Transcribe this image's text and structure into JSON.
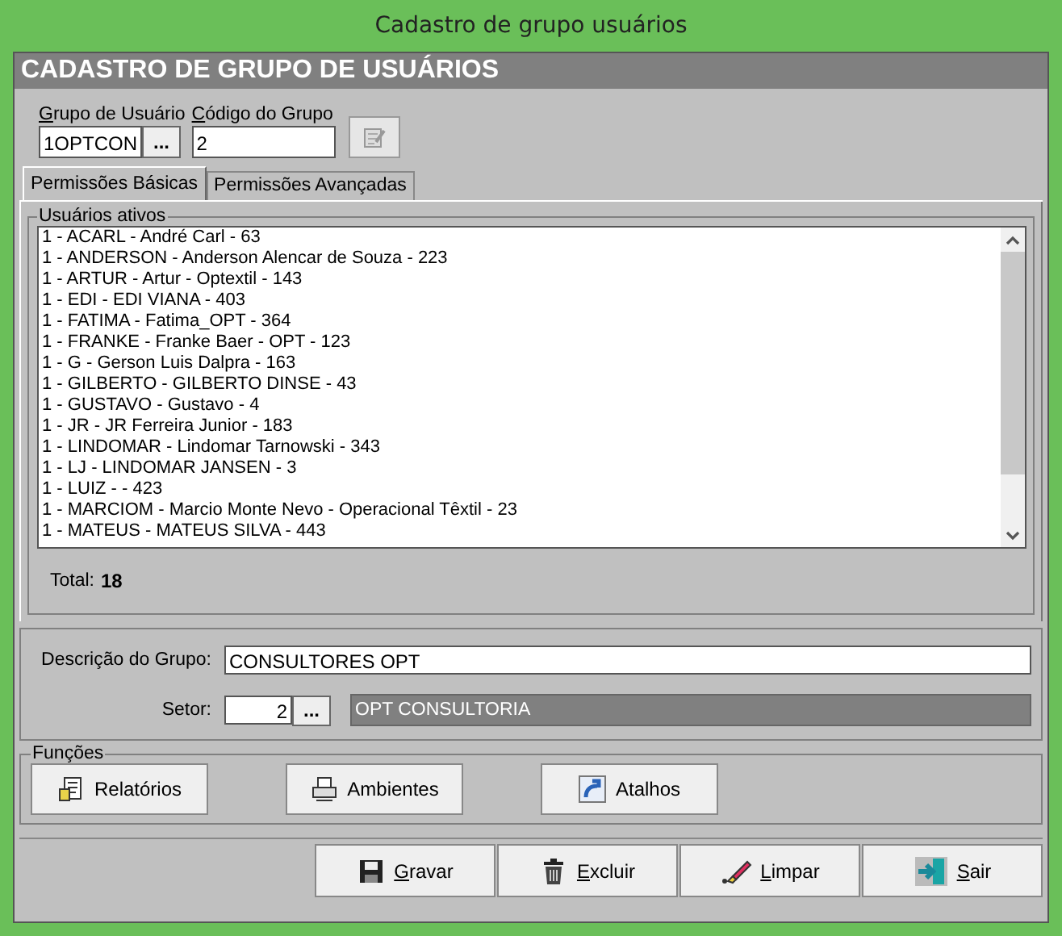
{
  "window": {
    "title": "Cadastro de grupo usuários"
  },
  "header": {
    "title": "CADASTRO DE GRUPO DE USUÁRIOS"
  },
  "top_fields": [
    {
      "label": "Grupo de Usuário",
      "value": "1OPTCON",
      "kind": "lookup",
      "button": "..."
    },
    {
      "label": "Código do Grupo",
      "value": "2",
      "kind": "text"
    }
  ],
  "tabs": [
    {
      "label": "Permissões Básicas",
      "selected": true
    },
    {
      "label": "Permissões Avançadas",
      "selected": false
    }
  ],
  "users_group": {
    "title": "Usuários ativos",
    "items": [
      "1 - ACARL - André Carl - 63",
      "1 - ANDERSON - Anderson Alencar de Souza - 223",
      "1 - ARTUR - Artur - Optextil - 143",
      "1 - EDI - EDI VIANA - 403",
      "1 - FATIMA - Fatima_OPT - 364",
      "1 - FRANKE - Franke Baer - OPT - 123",
      "1 - G - Gerson Luis Dalpra - 163",
      "1 - GILBERTO - GILBERTO DINSE - 43",
      "1 - GUSTAVO - Gustavo - 4",
      "1 - JR - JR Ferreira Junior - 183",
      "1 - LINDOMAR - Lindomar Tarnowski - 343",
      "1 - LJ - LINDOMAR JANSEN - 3",
      "1 - LUIZ -  - 423",
      "1 - MARCIOM - Marcio Monte Nevo - Operacional Têxtil - 23",
      "1 - MATEUS - MATEUS SILVA - 443"
    ],
    "total_label": "Total:",
    "total_value": "18"
  },
  "description": {
    "label": "Descrição do Grupo:",
    "value": "CONSULTORES OPT"
  },
  "sector": {
    "label": "Setor:",
    "code": "2",
    "button": "...",
    "name": "OPT CONSULTORIA"
  },
  "functions": {
    "title": "Funções",
    "buttons": [
      {
        "label": "Relatórios"
      },
      {
        "label": "Ambientes"
      },
      {
        "label": "Atalhos"
      }
    ]
  },
  "actions": [
    {
      "label": "Gravar"
    },
    {
      "label": "Excluir"
    },
    {
      "label": "Limpar"
    },
    {
      "label": "Sair"
    }
  ]
}
